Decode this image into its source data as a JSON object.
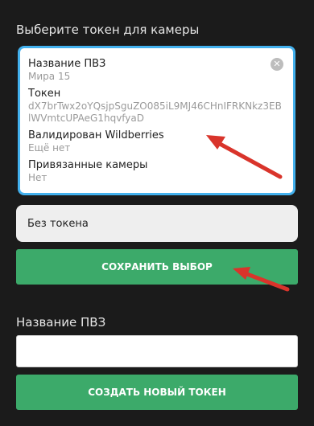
{
  "header": {
    "title": "Выберите токен для камеры"
  },
  "selected_token": {
    "fields": [
      {
        "label": "Название ПВЗ",
        "value": "Мира 15"
      },
      {
        "label": "Токен",
        "value": "dX7brTwx2oYQsjpSguZO085iL9MJ46CHnIFRKNkz3EBlWVmtcUPAeG1hqvfyaD"
      },
      {
        "label": "Валидирован Wildberries",
        "value": "Ещё нет"
      },
      {
        "label": "Привязанные камеры",
        "value": "Нет"
      }
    ],
    "clear_icon": "close-circle-icon"
  },
  "options": {
    "no_token_label": "Без токена"
  },
  "actions": {
    "save_label": "СОХРАНИТЬ ВЫБОР",
    "create_label": "СОЗДАТЬ НОВЫЙ ТОКЕН"
  },
  "new_token_form": {
    "name_label": "Название ПВЗ",
    "name_value": ""
  },
  "colors": {
    "accent_green": "#3caa6a",
    "selection_border": "#43b1ee",
    "annotation_arrow": "#d9342b",
    "background": "#1b1b1b"
  }
}
